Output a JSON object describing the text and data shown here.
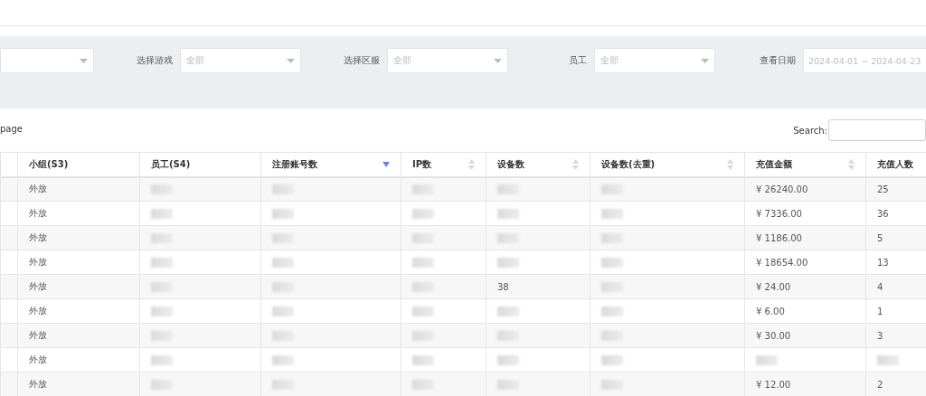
{
  "filters": [
    {
      "kind": "select"
    },
    {
      "kind": "select",
      "label": "选择游戏",
      "value": "全部"
    },
    {
      "kind": "select",
      "label": "选择区服",
      "value": "全部"
    },
    {
      "kind": "select",
      "label": "员工",
      "value": "全部"
    },
    {
      "kind": "date",
      "label": "查看日期",
      "value": "2024-04-01 ~ 2024-04-23"
    }
  ],
  "page_length_text": "page",
  "search": {
    "label": "Search:"
  },
  "table": {
    "columns": [
      {
        "kind": "plain",
        "label": "小组(S3)"
      },
      {
        "kind": "plain",
        "label": "员工(S4)"
      },
      {
        "kind": "sortable",
        "label": "注册账号数",
        "sorted": true
      },
      {
        "kind": "sortable",
        "label": "IP数",
        "sorted": false
      },
      {
        "kind": "sortable",
        "label": "设备数",
        "sorted": false
      },
      {
        "kind": "sortable",
        "label": "设备数(去重)",
        "sorted": false
      },
      {
        "kind": "sortable",
        "label": "充值金额",
        "sorted": false
      },
      {
        "kind": "plain",
        "label": "充值人数"
      }
    ],
    "rows": [
      {
        "cells": [
          {
            "text": "外放"
          },
          {
            "redacted": true
          },
          {
            "redacted": true
          },
          {
            "redacted": true
          },
          {
            "redacted": true
          },
          {
            "redacted": true
          },
          {
            "text": "¥ 26240.00"
          },
          {
            "text": "25"
          }
        ]
      },
      {
        "cells": [
          {
            "text": "外放"
          },
          {
            "redacted": true
          },
          {
            "redacted": true
          },
          {
            "redacted": true
          },
          {
            "redacted": true
          },
          {
            "redacted": true
          },
          {
            "text": "¥ 7336.00"
          },
          {
            "text": "36"
          }
        ]
      },
      {
        "cells": [
          {
            "text": "外放"
          },
          {
            "redacted": true
          },
          {
            "redacted": true
          },
          {
            "redacted": true
          },
          {
            "redacted": true
          },
          {
            "redacted": true
          },
          {
            "text": "¥ 1186.00"
          },
          {
            "text": "5"
          }
        ]
      },
      {
        "cells": [
          {
            "text": "外放"
          },
          {
            "redacted": true
          },
          {
            "redacted": true
          },
          {
            "redacted": true
          },
          {
            "redacted": true
          },
          {
            "redacted": true
          },
          {
            "text": "¥ 18654.00"
          },
          {
            "text": "13"
          }
        ]
      },
      {
        "cells": [
          {
            "text": "外放"
          },
          {
            "redacted": true
          },
          {
            "redacted": true
          },
          {
            "redacted": true
          },
          {
            "text": "38"
          },
          {
            "redacted": true
          },
          {
            "text": "¥ 24.00"
          },
          {
            "text": "4"
          }
        ]
      },
      {
        "cells": [
          {
            "text": "外放"
          },
          {
            "redacted": true
          },
          {
            "redacted": true
          },
          {
            "redacted": true
          },
          {
            "redacted": true
          },
          {
            "redacted": true
          },
          {
            "text": "¥ 6.00"
          },
          {
            "text": "1"
          }
        ]
      },
      {
        "cells": [
          {
            "text": "外放"
          },
          {
            "redacted": true
          },
          {
            "redacted": true
          },
          {
            "redacted": true
          },
          {
            "redacted": true
          },
          {
            "redacted": true
          },
          {
            "text": "¥ 30.00"
          },
          {
            "text": "3"
          }
        ]
      },
      {
        "cells": [
          {
            "text": "外放"
          },
          {
            "redacted": true
          },
          {
            "redacted": true
          },
          {
            "redacted": true
          },
          {
            "redacted": true
          },
          {
            "redacted": true
          },
          {
            "redacted": true
          },
          {
            "redacted": true
          }
        ]
      },
      {
        "cells": [
          {
            "text": "外放"
          },
          {
            "redacted": true
          },
          {
            "redacted": true
          },
          {
            "redacted": true
          },
          {
            "redacted": true
          },
          {
            "redacted": true
          },
          {
            "text": "¥ 12.00"
          },
          {
            "text": "2"
          }
        ]
      }
    ]
  }
}
